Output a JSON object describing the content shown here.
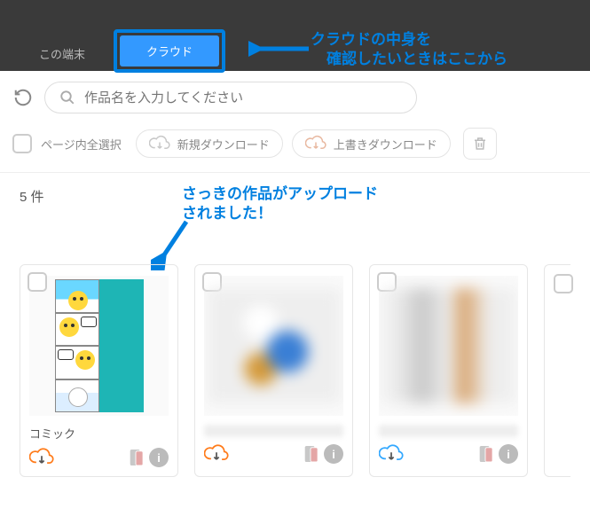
{
  "tabs": {
    "device": "この端末",
    "cloud": "クラウド"
  },
  "annotations": {
    "top1": "クラウドの中身を",
    "top2": "確認したいときはここから",
    "mid1": "さっきの作品がアップロード",
    "mid2": "されました！"
  },
  "search": {
    "placeholder": "作品名を入力してください"
  },
  "toolbar": {
    "select_all": "ページ内全選択",
    "new_download": "新規ダウンロード",
    "overwrite_download": "上書きダウンロード"
  },
  "count_label": "5 件",
  "cards": [
    {
      "title": "コミック"
    },
    {
      "title": ""
    },
    {
      "title": ""
    }
  ],
  "icons": {
    "info": "i"
  },
  "colors": {
    "accent": "#0080e0",
    "cloud_orange": "#ff7b1a",
    "cloud_blue": "#33a8ff"
  }
}
